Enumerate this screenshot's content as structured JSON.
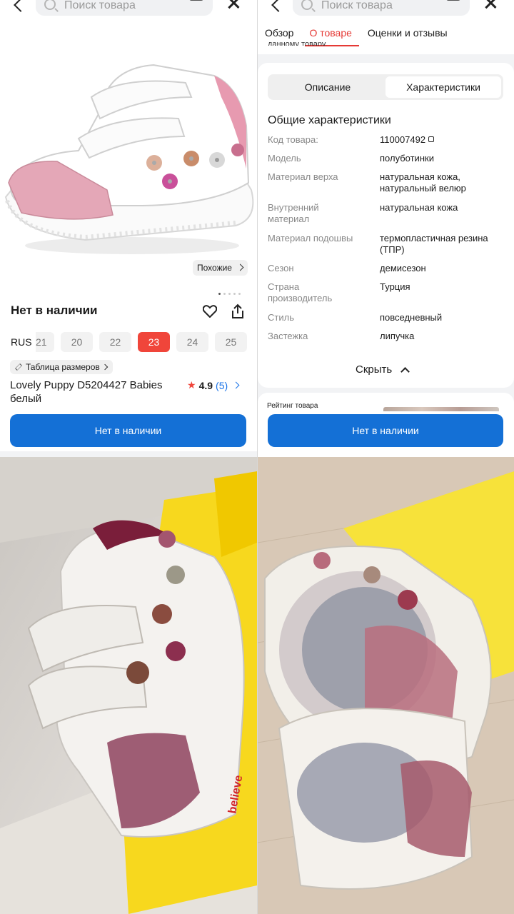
{
  "search": {
    "placeholder": "Поиск товара"
  },
  "left": {
    "similar_label": "Похожие",
    "stock_title": "Нет в наличии",
    "size_system": "RUS",
    "sizes": [
      "21",
      "20",
      "22",
      "23",
      "24",
      "25"
    ],
    "selected_size": "23",
    "size_table_label": "Таблица размеров",
    "product_name": "Lovely Puppy D5204427 Babies белый",
    "rating_value": "4.9",
    "rating_count": "(5)",
    "cta_label": "Нет в наличии"
  },
  "right": {
    "tabs": [
      "Обзор",
      "О товаре",
      "Оценки и отзывы"
    ],
    "active_tab": "О товаре",
    "cut_text": "данному товару.",
    "segments": [
      "Описание",
      "Характеристики"
    ],
    "active_segment": "Характеристики",
    "section_title": "Общие характеристики",
    "specs": [
      {
        "k": "Код товара:",
        "v": "110007492"
      },
      {
        "k": "Модель",
        "v": "полуботинки"
      },
      {
        "k": "Материал верха",
        "v": "натуральная кожа, натуральный велюр"
      },
      {
        "k": "Внутренний материал",
        "v": "натуральная кожа"
      },
      {
        "k": "Материал подошвы",
        "v": "термопластичная резина (ТПР)"
      },
      {
        "k": "Сезон",
        "v": "демисезон"
      },
      {
        "k": "Страна производитель",
        "v": "Турция"
      },
      {
        "k": "Стиль",
        "v": "повседневный"
      },
      {
        "k": "Застежка",
        "v": "липучка"
      }
    ],
    "hide_label": "Скрыть",
    "rating_label": "Рейтинг товара",
    "cta_label": "Нет в наличии"
  },
  "photos": {
    "box_text": "believe"
  },
  "colors": {
    "accent_red": "#f0453a",
    "cta_blue": "#1470d6",
    "box_yellow": "#f7d81e"
  }
}
